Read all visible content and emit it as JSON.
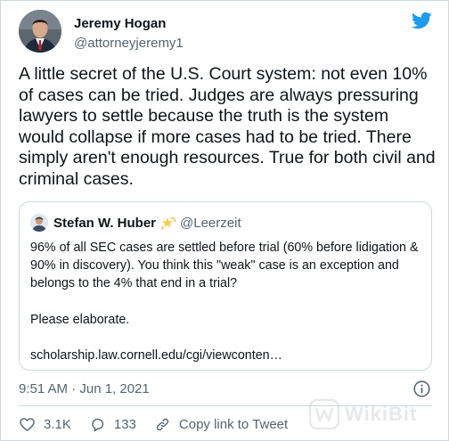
{
  "author": {
    "display_name": "Jeremy Hogan",
    "handle": "@attorneyjeremy1",
    "avatar_icon": "person-photo-icon"
  },
  "brand": {
    "icon": "twitter-bird-icon",
    "color": "#1d9bf0"
  },
  "tweet": {
    "text": "A little secret of the U.S. Court system: not even 10% of cases can be tried. Judges are always pressuring lawyers to settle because the truth is the system would collapse if more cases had to be tried. There simply aren't enough resources. True for both civil and criminal cases."
  },
  "quoted_tweet": {
    "display_name": "Stefan W. Huber",
    "emoji_icon": "dizzy-star-emoji-icon",
    "handle": "@Leerzeit",
    "paragraphs": [
      "96% of all SEC cases are settled before trial (60% before lidigation & 90% in discovery). You think this \"weak\" case is an exception and belongs to the 4% that end in a trial?",
      "Please elaborate.",
      "scholarship.law.cornell.edu/cgi/viewconten…"
    ]
  },
  "meta": {
    "timestamp": "9:51 AM · Jun 1, 2021",
    "info_icon": "info-icon"
  },
  "actions": {
    "like_count": "3.1K",
    "reply_count": "133",
    "copy_link_label": "Copy link to Tweet"
  },
  "watermark": {
    "text": "WikiBit"
  },
  "colors": {
    "text": "#0f1419",
    "secondary": "#536471",
    "border": "#cfd9de"
  }
}
